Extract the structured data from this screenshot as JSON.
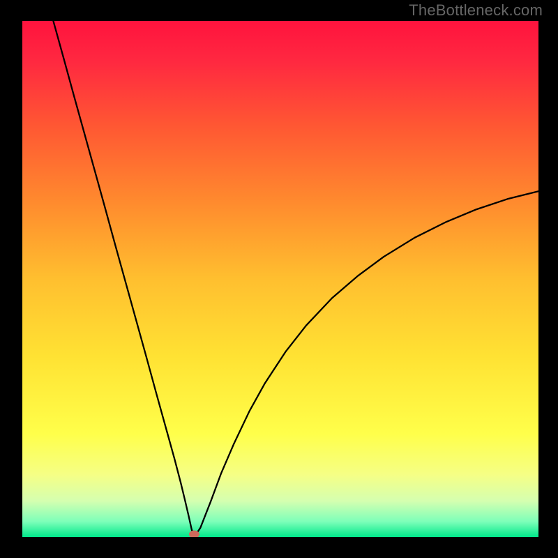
{
  "watermark": "TheBottleneck.com",
  "chart_data": {
    "type": "line",
    "title": "",
    "xlabel": "",
    "ylabel": "",
    "xlim": [
      0,
      100
    ],
    "ylim": [
      0,
      100
    ],
    "grid": false,
    "background_gradient_stops": [
      {
        "offset": 0,
        "color": "#ff133e"
      },
      {
        "offset": 0.08,
        "color": "#ff2940"
      },
      {
        "offset": 0.2,
        "color": "#ff5633"
      },
      {
        "offset": 0.35,
        "color": "#ff8a2e"
      },
      {
        "offset": 0.5,
        "color": "#ffbf2f"
      },
      {
        "offset": 0.65,
        "color": "#ffe233"
      },
      {
        "offset": 0.8,
        "color": "#ffff4a"
      },
      {
        "offset": 0.88,
        "color": "#f5ff86"
      },
      {
        "offset": 0.93,
        "color": "#d5ffb0"
      },
      {
        "offset": 0.97,
        "color": "#7dffb9"
      },
      {
        "offset": 1.0,
        "color": "#00e88b"
      }
    ],
    "series": [
      {
        "name": "bottleneck-curve",
        "x": [
          6,
          8,
          10,
          12,
          14,
          16,
          18,
          20,
          22,
          24,
          26,
          28,
          29.5,
          30.7,
          31.5,
          32.2,
          32.8,
          33.3,
          34.5,
          36.5,
          38.5,
          41,
          44,
          47,
          51,
          55,
          60,
          65,
          70,
          76,
          82,
          88,
          94,
          100
        ],
        "y": [
          100,
          92.8,
          85.5,
          78.3,
          71.1,
          63.9,
          56.6,
          49.4,
          42.2,
          35.0,
          27.7,
          20.5,
          15.1,
          10.5,
          7.2,
          4.2,
          1.5,
          0.0,
          1.8,
          6.9,
          12.3,
          18.1,
          24.4,
          29.8,
          35.9,
          41.0,
          46.3,
          50.6,
          54.3,
          58.0,
          61.0,
          63.5,
          65.5,
          67.0
        ]
      }
    ],
    "marker": {
      "name": "optimal-point",
      "x": 33.3,
      "y": 0.0,
      "color": "#cf6a5c"
    }
  }
}
